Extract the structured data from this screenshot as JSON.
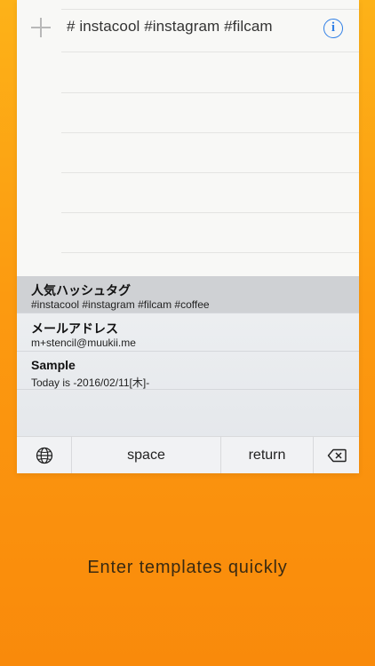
{
  "note": {
    "text": "# instacool #instagram #filcam"
  },
  "templates": [
    {
      "title": "人気ハッシュタグ",
      "body": "#instacool #instagram #filcam #coffee",
      "selected": true
    },
    {
      "title": "メールアドレス",
      "body": "m+stencil@muukii.me",
      "selected": false
    },
    {
      "title": "Sample",
      "body": "Today is -2016/02/11[木]-",
      "selected": false
    }
  ],
  "keyboard": {
    "space_label": "space",
    "return_label": "return"
  },
  "caption": "Enter templates quickly",
  "colors": {
    "background_top": "#fdb218",
    "background_bottom": "#f98a0b",
    "accent": "#2f7fe6"
  },
  "icons": {
    "add": "plus-icon",
    "info": "info-icon",
    "globe": "globe-icon",
    "delete": "backspace-icon"
  }
}
